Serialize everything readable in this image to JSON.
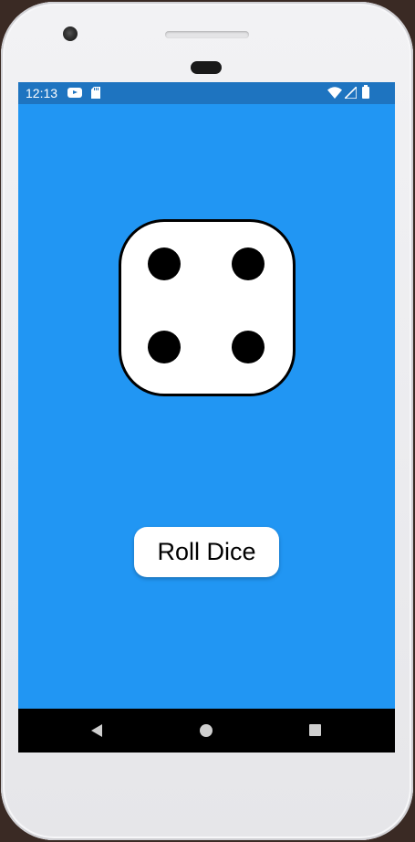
{
  "status_bar": {
    "time": "12:13",
    "icons": [
      "youtube-icon",
      "sd-card-icon",
      "wifi-icon",
      "signal-icon",
      "battery-icon"
    ],
    "background_color": "#1e74c0"
  },
  "app": {
    "background_color": "#2196f3",
    "dice": {
      "value": 4
    },
    "roll_button_label": "Roll Dice"
  },
  "nav_bar": {
    "icons": [
      "back-icon",
      "home-icon",
      "recents-icon"
    ]
  }
}
